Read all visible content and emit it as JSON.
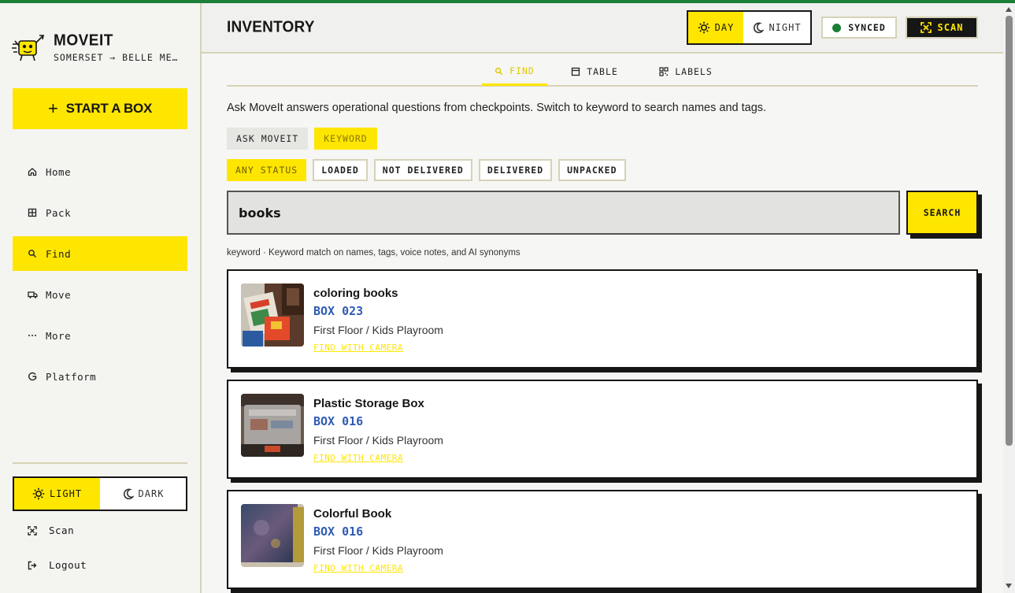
{
  "app": {
    "name": "MOVEIT",
    "subtitle": "SOMERSET → BELLE ME…"
  },
  "sidebar": {
    "start_box_label": "START A BOX",
    "items": [
      {
        "label": "Home",
        "icon": "home-icon"
      },
      {
        "label": "Pack",
        "icon": "pack-icon"
      },
      {
        "label": "Find",
        "icon": "search-icon",
        "active": true
      },
      {
        "label": "Move",
        "icon": "truck-icon"
      },
      {
        "label": "More",
        "icon": "more-icon"
      },
      {
        "label": "Platform",
        "icon": "platform-icon"
      }
    ],
    "theme": {
      "light": "LIGHT",
      "dark": "DARK",
      "selected": "light"
    },
    "scan_label": "Scan",
    "logout_label": "Logout"
  },
  "header": {
    "title": "INVENTORY",
    "day_label": "DAY",
    "night_label": "NIGHT",
    "selected_mode": "day",
    "sync_label": "SYNCED",
    "scan_label": "SCAN"
  },
  "tabs": [
    {
      "label": "FIND",
      "icon": "search-icon",
      "active": true
    },
    {
      "label": "TABLE",
      "icon": "table-icon"
    },
    {
      "label": "LABELS",
      "icon": "qr-icon"
    }
  ],
  "find": {
    "intro": "Ask MoveIt answers operational questions from checkpoints. Switch to keyword to search names and tags.",
    "modes": [
      {
        "label": "ASK MOVEIT"
      },
      {
        "label": "KEYWORD",
        "active": true
      }
    ],
    "statuses": [
      {
        "label": "ANY STATUS",
        "active": true
      },
      {
        "label": "LOADED"
      },
      {
        "label": "NOT DELIVERED"
      },
      {
        "label": "DELIVERED"
      },
      {
        "label": "UNPACKED"
      }
    ],
    "search_value": "books",
    "search_button": "SEARCH",
    "hint": "keyword · Keyword match on names, tags, voice notes, and AI synonyms"
  },
  "results": [
    {
      "name": "coloring books",
      "box": "BOX 023",
      "location": "First Floor / Kids Playroom",
      "action": "FIND WITH CAMERA"
    },
    {
      "name": "Plastic Storage Box",
      "box": "BOX 016",
      "location": "First Floor / Kids Playroom",
      "action": "FIND WITH CAMERA"
    },
    {
      "name": "Colorful Book",
      "box": "BOX 016",
      "location": "First Floor / Kids Playroom",
      "action": "FIND WITH CAMERA"
    }
  ],
  "colors": {
    "accent": "#ffe600",
    "sync_green": "#1a7f37",
    "box_blue": "#2f5bb5",
    "ink": "#161616",
    "border": "#d6d2b8"
  }
}
